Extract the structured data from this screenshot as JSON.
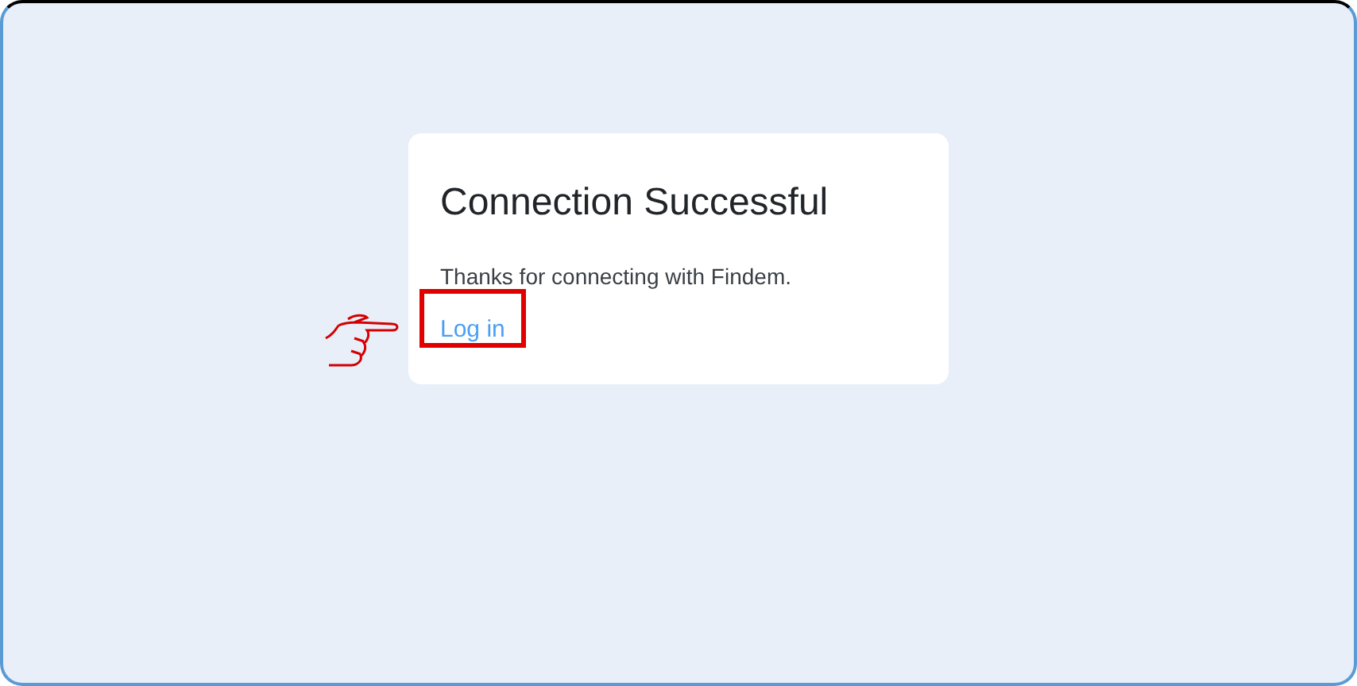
{
  "card": {
    "title": "Connection Successful",
    "message": "Thanks for connecting with Findem.",
    "link": "Log in"
  }
}
